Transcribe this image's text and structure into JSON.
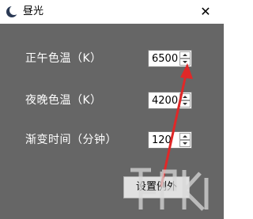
{
  "window": {
    "title": "昼光",
    "close_glyph": "✕"
  },
  "settings": {
    "rows": [
      {
        "label": "正午色温（K）",
        "value": "6500"
      },
      {
        "label": "夜晚色温（K）",
        "value": "4200"
      },
      {
        "label": "渐变时间（分钟）",
        "value": "120"
      }
    ]
  },
  "buttons": {
    "exceptions_label": "设置例外"
  },
  "annotation": {
    "arrow_color": "#e02828"
  },
  "icons": {
    "app": "moon-icon",
    "close": "close-icon",
    "spin_up": "chevron-up-icon",
    "spin_down": "chevron-down-icon"
  },
  "colors": {
    "client_background": "#666666",
    "label_text": "#ffffff"
  }
}
